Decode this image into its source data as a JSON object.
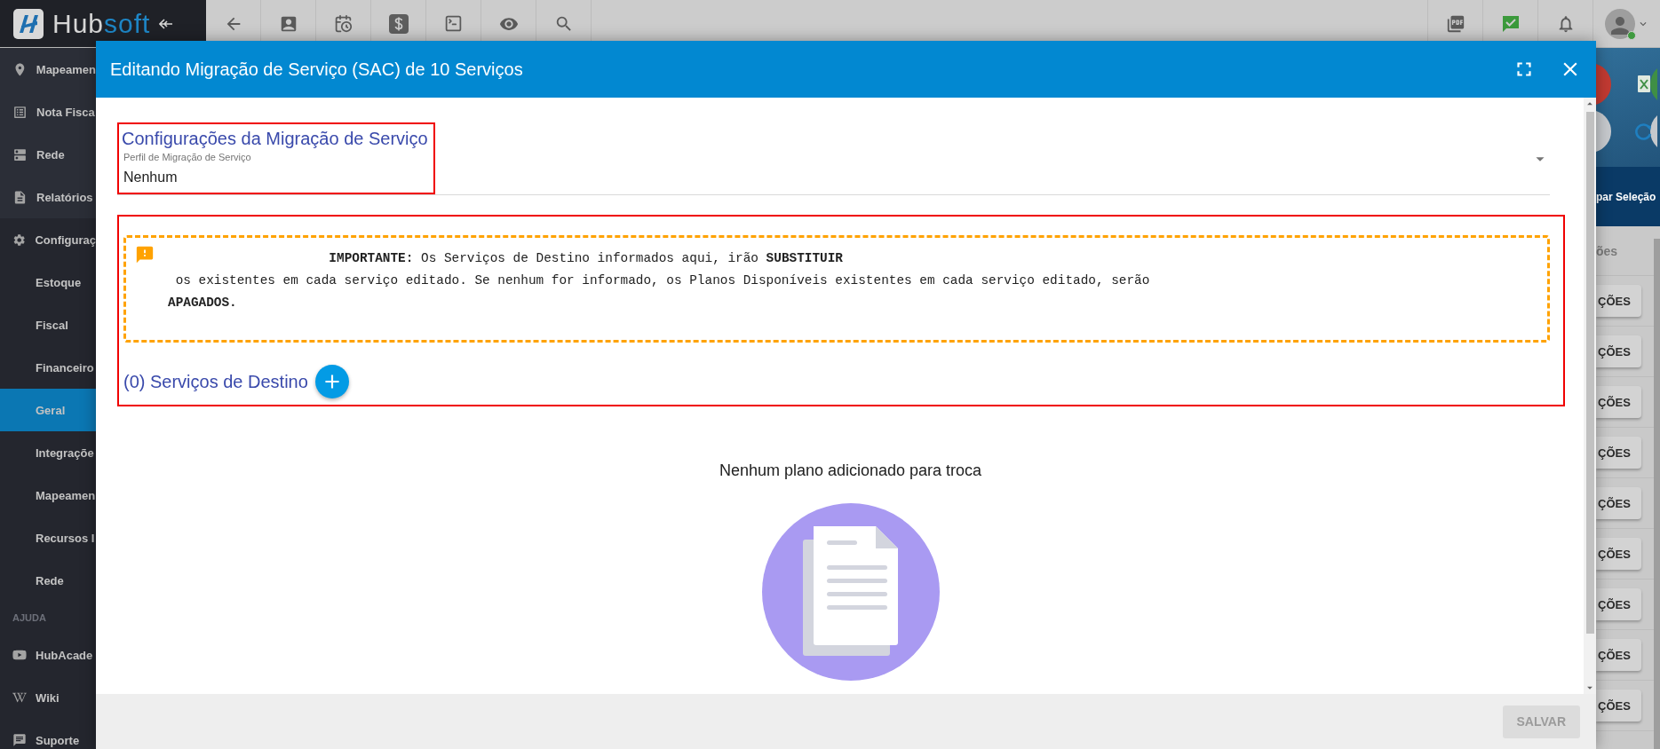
{
  "brand": {
    "name_start": "Hub",
    "name_end": "soft"
  },
  "sidebar": {
    "items": [
      {
        "label": "Mapeamen",
        "selected": false
      },
      {
        "label": "Nota Fisca",
        "selected": false
      },
      {
        "label": "Rede",
        "selected": false
      },
      {
        "label": "Relatórios",
        "selected": false
      },
      {
        "label": "Configuraç",
        "selected": false,
        "expanded": true,
        "children": [
          {
            "label": "Estoque",
            "selected": false
          },
          {
            "label": "Fiscal",
            "selected": false
          },
          {
            "label": "Financeiro",
            "selected": false
          },
          {
            "label": "Geral",
            "selected": true
          },
          {
            "label": "Integraçõe",
            "selected": false
          },
          {
            "label": "Mapeamen",
            "selected": false
          },
          {
            "label": "Recursos I",
            "selected": false
          },
          {
            "label": "Rede",
            "selected": false
          }
        ]
      }
    ],
    "help_heading": "AJUDA",
    "help_items": [
      {
        "label": "HubAcade",
        "selected": false
      },
      {
        "label": "Wiki",
        "selected": false
      },
      {
        "label": "Suporte",
        "selected": false
      }
    ]
  },
  "dialog": {
    "title": "Editando Migração de Serviço (SAC) de 10 Serviços",
    "settings_section": {
      "title": "Configurações da Migração de Serviço",
      "field_label": "Perfil de Migração de Serviço",
      "field_value": "Nenhum"
    },
    "notice": "                     **IMPORTANTE:** Os Serviços de Destino informados aqui, irão **SUBSTITUIR**\n os existentes em cada serviço editado. Se nenhum for informado, os Planos Disponíveis existentes em cada serviço editado, serão\n**APAGADOS.**",
    "destinations_heading": "(0) Serviços de Destino",
    "empty_message": "Nenhum plano adicionado para troca",
    "save_button": {
      "label": "SALVAR",
      "disabled": true
    }
  },
  "background_table": {
    "bulk_action": "par Seleção",
    "column_header": "ões",
    "row_buttons": [
      "ÇÕES",
      "ÇÕES",
      "ÇÕES",
      "ÇÕES",
      "ÇÕES",
      "ÇÕES",
      "ÇÕES",
      "ÇÕES",
      "ÇÕES"
    ]
  }
}
